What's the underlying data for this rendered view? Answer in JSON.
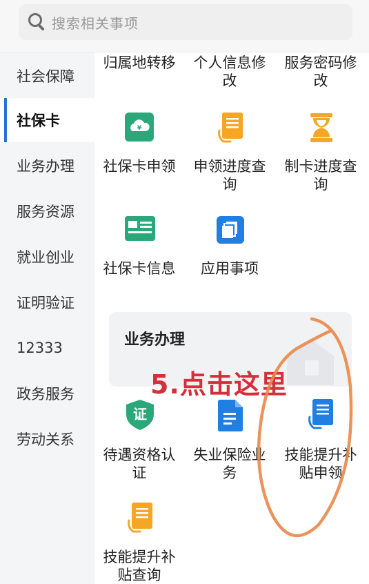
{
  "search": {
    "placeholder": "搜索相关事项"
  },
  "sidebar": {
    "items": [
      {
        "label": "社会保障",
        "active": false
      },
      {
        "label": "社保卡",
        "active": true
      },
      {
        "label": "业务办理",
        "active": false
      },
      {
        "label": "服务资源",
        "active": false
      },
      {
        "label": "就业创业",
        "active": false
      },
      {
        "label": "证明验证",
        "active": false
      },
      {
        "label": "12333",
        "active": false
      },
      {
        "label": "政务服务",
        "active": false
      },
      {
        "label": "劳动关系",
        "active": false
      }
    ]
  },
  "card_section": {
    "top_row": [
      {
        "line1": "归属地转移",
        "line2": ""
      },
      {
        "line1": "个人信息修",
        "line2": "改"
      },
      {
        "line1": "服务密码修",
        "line2": "改"
      }
    ],
    "row2": [
      {
        "line1": "社保卡申领",
        "line2": "",
        "icon": "card-cloud-icon"
      },
      {
        "line1": "申领进度查",
        "line2": "询",
        "icon": "document-hand-icon"
      },
      {
        "line1": "制卡进度查",
        "line2": "询",
        "icon": "hourglass-icon"
      }
    ],
    "row3": [
      {
        "line1": "社保卡信息",
        "line2": "",
        "icon": "id-card-icon"
      },
      {
        "line1": "应用事项",
        "line2": "",
        "icon": "stacked-cards-icon"
      }
    ]
  },
  "business_section": {
    "title": "业务办理",
    "row1": [
      {
        "line1": "待遇资格认",
        "line2": "证",
        "icon": "shield-cert-icon"
      },
      {
        "line1": "失业保险业",
        "line2": "务",
        "icon": "file-icon"
      },
      {
        "line1": "技能提升补",
        "line2": "贴申领",
        "icon": "document-hand-blue-icon"
      }
    ],
    "row2": [
      {
        "line1": "技能提升补",
        "line2": "贴查询",
        "icon": "document-hand-icon"
      }
    ]
  },
  "annotation": {
    "text": "5.点击这里",
    "color": "#d4303c"
  },
  "colors": {
    "accent": "#2b6fd8",
    "green": "#2aa87a",
    "orange": "#f5a623",
    "blue": "#1f7fe3",
    "annotation_circle": "#e8884a"
  },
  "shield_icon_glyph": "证"
}
